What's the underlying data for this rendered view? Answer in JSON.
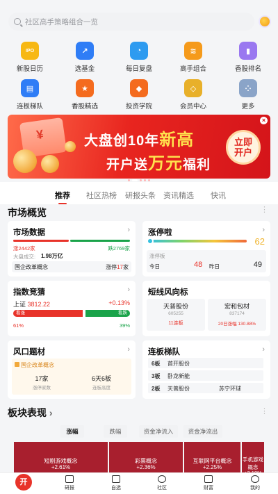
{
  "search": {
    "placeholder": "社区高手策略组合一览"
  },
  "shortcuts": [
    {
      "label": "新股日历",
      "icon": "ipo-calendar-icon",
      "glyph": "IPO",
      "color": "#f7b814"
    },
    {
      "label": "选基金",
      "icon": "fund-chart-icon",
      "glyph": "↗",
      "color": "#2f7df6"
    },
    {
      "label": "每日复盘",
      "icon": "pie-chart-icon",
      "glyph": "◔",
      "color": "#2e9bf0"
    },
    {
      "label": "高手组合",
      "icon": "stack-icon",
      "glyph": "≋",
      "color": "#f59a1b"
    },
    {
      "label": "香股排名",
      "icon": "bar-chart-icon",
      "glyph": "▮",
      "color": "#9a78f0"
    },
    {
      "label": "连板梯队",
      "icon": "ladder-icon",
      "glyph": "▤",
      "color": "#2f7df6",
      "badge": "热门"
    },
    {
      "label": "香股精选",
      "icon": "star-trophy-icon",
      "glyph": "★",
      "color": "#f46b1e",
      "badge": "精选"
    },
    {
      "label": "投资学院",
      "icon": "graduation-icon",
      "glyph": "◆",
      "color": "#f46b1e"
    },
    {
      "label": "会员中心",
      "icon": "diamond-icon",
      "glyph": "◇",
      "color": "#e8b02a"
    },
    {
      "label": "更多",
      "icon": "more-grid-icon",
      "glyph": "⁘",
      "color": "#8aa4c8"
    }
  ],
  "banner": {
    "line1_a": "大盘创10年",
    "line1_b": "新高",
    "line2_a": "开户送",
    "line2_b": "万元",
    "line2_c": "福利",
    "button": "立即开户",
    "close": "×"
  },
  "tabs": [
    "推荐",
    "社区热榜",
    "研报头条",
    "资讯精选",
    "快讯"
  ],
  "market_title": "市场概览",
  "market_data": {
    "title": "市场数据",
    "up": "涨2442家",
    "down": "跌2769家",
    "up_count": 2442,
    "down_count": 2769,
    "volume_label": "大盘成交:",
    "volume_value": "1.98万亿",
    "concept": "国企改革概念",
    "concept_stat_label": "涨停",
    "concept_stat_value": "17",
    "concept_stat_unit": "家"
  },
  "limit_up": {
    "title": "涨停啦",
    "score": "62",
    "label": "涨停板",
    "today_label": "今日",
    "today_value": "48",
    "yesterday_label": "昨日",
    "yesterday_value": "49"
  },
  "index_guess": {
    "title": "指数竞猜",
    "index_name": "上证",
    "index_value": "3812.22",
    "change": "+0.13%",
    "bull_label": "看涨",
    "bear_label": "看跌",
    "bull_pct": "61%",
    "bear_pct": "39%",
    "bull_fraction": 0.61
  },
  "short_line": {
    "title": "短线风向标",
    "stocks": [
      {
        "name": "天普股份",
        "code": "605255",
        "tag": "11连板"
      },
      {
        "name": "宏和包材",
        "code": "837174",
        "tag": "20日涨幅 130.88%"
      }
    ]
  },
  "themes": {
    "title": "风口题材",
    "name": "国企改革概念",
    "stat1_value": "17家",
    "stat1_label": "涨停家数",
    "stat2_value": "6天6板",
    "stat2_label": "连板高度"
  },
  "ladder": {
    "title": "连板梯队",
    "rows": [
      {
        "level": "6板",
        "stocks": [
          "首开股份",
          ""
        ]
      },
      {
        "level": "3板",
        "stocks": [
          "卧龙新能",
          ""
        ]
      },
      {
        "level": "2板",
        "stocks": [
          "天普股份",
          "苏宁环球"
        ]
      }
    ]
  },
  "sector": {
    "title": "板块表现",
    "tabs": [
      "涨幅",
      "跌幅",
      "资金净流入",
      "资金净流出"
    ],
    "tiles": [
      {
        "name": "短剧游戏概念",
        "pct": "+2.61%"
      },
      {
        "name": "彩票概念",
        "pct": "+2.36%"
      },
      {
        "name": "互联网平台概念",
        "pct": "+2.25%"
      },
      {
        "name": "手机游戏概念",
        "pct": "+2.19%"
      }
    ]
  },
  "bottom_nav": [
    {
      "label": "",
      "icon": "home-logo-icon"
    },
    {
      "label": "研报",
      "icon": "report-icon"
    },
    {
      "label": "自选",
      "icon": "watchlist-chart-icon"
    },
    {
      "label": "社区",
      "icon": "community-icon"
    },
    {
      "label": "财富",
      "icon": "wallet-icon"
    },
    {
      "label": "我的",
      "icon": "profile-smile-icon"
    }
  ]
}
